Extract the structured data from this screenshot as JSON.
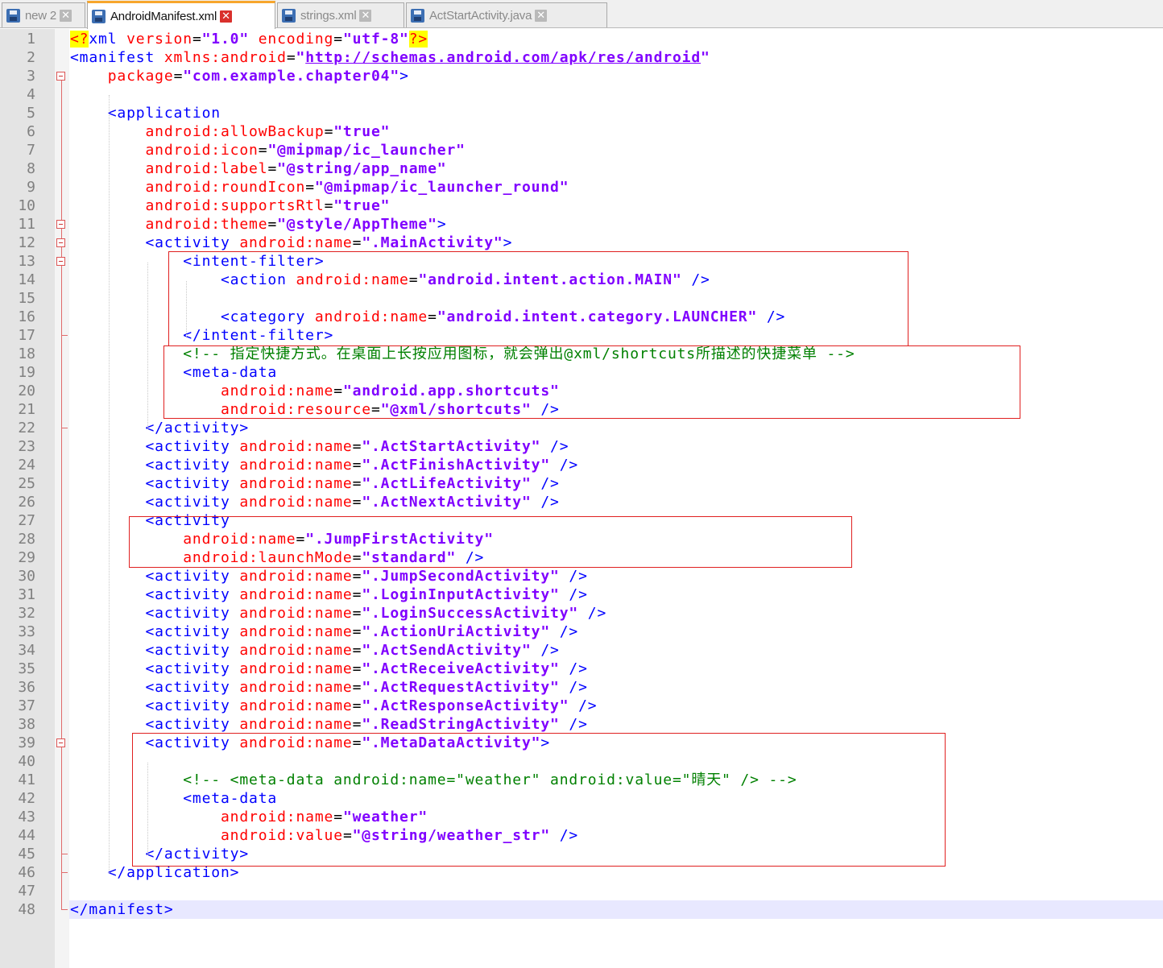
{
  "tabs": [
    {
      "label": "new 2",
      "active": false
    },
    {
      "label": "AndroidManifest.xml",
      "active": true
    },
    {
      "label": "strings.xml",
      "active": false
    },
    {
      "label": "ActStartActivity.java",
      "active": false
    }
  ],
  "close_glyph": "✕",
  "colors": {
    "tag": "#0000ff",
    "attribute": "#ff0000",
    "value": "#8000ff",
    "comment": "#008000",
    "highlight_box": "#e02020",
    "current_line": "#e8e8ff",
    "active_tab_accent": "#f7a62c"
  },
  "current_line": 48,
  "lines": [
    {
      "n": "1",
      "segs": [
        [
          "pi",
          "<?"
        ],
        [
          "tg",
          "xml "
        ],
        [
          "at",
          "version"
        ],
        [
          "eq",
          "="
        ],
        [
          "vl",
          "\"1.0\""
        ],
        [
          "tg",
          " "
        ],
        [
          "at",
          "encoding"
        ],
        [
          "eq",
          "="
        ],
        [
          "vl",
          "\"utf-8\""
        ],
        [
          "pi",
          "?>"
        ]
      ]
    },
    {
      "n": "2",
      "segs": [
        [
          "tg",
          "<manifest "
        ],
        [
          "at",
          "xmlns:android"
        ],
        [
          "eq",
          "="
        ],
        [
          "vl",
          "\""
        ],
        [
          "url",
          "http://schemas.android.com/apk/res/android"
        ],
        [
          "vl",
          "\""
        ]
      ]
    },
    {
      "n": "3",
      "segs": [
        [
          "tg",
          "    "
        ],
        [
          "at",
          "package"
        ],
        [
          "eq",
          "="
        ],
        [
          "vl",
          "\"com.example.chapter04\""
        ],
        [
          "tg",
          ">"
        ]
      ]
    },
    {
      "n": "4",
      "segs": []
    },
    {
      "n": "5",
      "segs": [
        [
          "tg",
          "    <application"
        ]
      ]
    },
    {
      "n": "6",
      "segs": [
        [
          "tg",
          "        "
        ],
        [
          "at",
          "android:allowBackup"
        ],
        [
          "eq",
          "="
        ],
        [
          "vl",
          "\"true\""
        ]
      ]
    },
    {
      "n": "7",
      "segs": [
        [
          "tg",
          "        "
        ],
        [
          "at",
          "android:icon"
        ],
        [
          "eq",
          "="
        ],
        [
          "vl",
          "\"@mipmap/ic_launcher\""
        ]
      ]
    },
    {
      "n": "8",
      "segs": [
        [
          "tg",
          "        "
        ],
        [
          "at",
          "android:label"
        ],
        [
          "eq",
          "="
        ],
        [
          "vl",
          "\"@string/app_name\""
        ]
      ]
    },
    {
      "n": "9",
      "segs": [
        [
          "tg",
          "        "
        ],
        [
          "at",
          "android:roundIcon"
        ],
        [
          "eq",
          "="
        ],
        [
          "vl",
          "\"@mipmap/ic_launcher_round\""
        ]
      ]
    },
    {
      "n": "10",
      "segs": [
        [
          "tg",
          "        "
        ],
        [
          "at",
          "android:supportsRtl"
        ],
        [
          "eq",
          "="
        ],
        [
          "vl",
          "\"true\""
        ]
      ]
    },
    {
      "n": "11",
      "segs": [
        [
          "tg",
          "        "
        ],
        [
          "at",
          "android:theme"
        ],
        [
          "eq",
          "="
        ],
        [
          "vl",
          "\"@style/AppTheme\""
        ],
        [
          "tg",
          ">"
        ]
      ]
    },
    {
      "n": "12",
      "segs": [
        [
          "tg",
          "        <activity "
        ],
        [
          "at",
          "android:name"
        ],
        [
          "eq",
          "="
        ],
        [
          "vl",
          "\".MainActivity\""
        ],
        [
          "tg",
          ">"
        ]
      ]
    },
    {
      "n": "13",
      "segs": [
        [
          "tg",
          "            <intent-filter>"
        ]
      ]
    },
    {
      "n": "14",
      "segs": [
        [
          "tg",
          "                <action "
        ],
        [
          "at",
          "android:name"
        ],
        [
          "eq",
          "="
        ],
        [
          "vl",
          "\"android.intent.action.MAIN\""
        ],
        [
          "tg",
          " />"
        ]
      ]
    },
    {
      "n": "15",
      "segs": []
    },
    {
      "n": "16",
      "segs": [
        [
          "tg",
          "                <category "
        ],
        [
          "at",
          "android:name"
        ],
        [
          "eq",
          "="
        ],
        [
          "vl",
          "\"android.intent.category.LAUNCHER\""
        ],
        [
          "tg",
          " />"
        ]
      ]
    },
    {
      "n": "17",
      "segs": [
        [
          "tg",
          "            </intent-filter>"
        ]
      ]
    },
    {
      "n": "18",
      "segs": [
        [
          "tg",
          "            "
        ],
        [
          "cm",
          "<!-- 指定快捷方式。在桌面上长按应用图标，就会弹出@xml/shortcuts所描述的快捷菜单 -->"
        ]
      ]
    },
    {
      "n": "19",
      "segs": [
        [
          "tg",
          "            <meta-data"
        ]
      ]
    },
    {
      "n": "20",
      "segs": [
        [
          "tg",
          "                "
        ],
        [
          "at",
          "android:name"
        ],
        [
          "eq",
          "="
        ],
        [
          "vl",
          "\"android.app.shortcuts\""
        ]
      ]
    },
    {
      "n": "21",
      "segs": [
        [
          "tg",
          "                "
        ],
        [
          "at",
          "android:resource"
        ],
        [
          "eq",
          "="
        ],
        [
          "vl",
          "\"@xml/shortcuts\""
        ],
        [
          "tg",
          " />"
        ]
      ]
    },
    {
      "n": "22",
      "segs": [
        [
          "tg",
          "        </activity>"
        ]
      ]
    },
    {
      "n": "23",
      "segs": [
        [
          "tg",
          "        <activity "
        ],
        [
          "at",
          "android:name"
        ],
        [
          "eq",
          "="
        ],
        [
          "vl",
          "\".ActStartActivity\""
        ],
        [
          "tg",
          " />"
        ]
      ]
    },
    {
      "n": "24",
      "segs": [
        [
          "tg",
          "        <activity "
        ],
        [
          "at",
          "android:name"
        ],
        [
          "eq",
          "="
        ],
        [
          "vl",
          "\".ActFinishActivity\""
        ],
        [
          "tg",
          " />"
        ]
      ]
    },
    {
      "n": "25",
      "segs": [
        [
          "tg",
          "        <activity "
        ],
        [
          "at",
          "android:name"
        ],
        [
          "eq",
          "="
        ],
        [
          "vl",
          "\".ActLifeActivity\""
        ],
        [
          "tg",
          " />"
        ]
      ]
    },
    {
      "n": "26",
      "segs": [
        [
          "tg",
          "        <activity "
        ],
        [
          "at",
          "android:name"
        ],
        [
          "eq",
          "="
        ],
        [
          "vl",
          "\".ActNextActivity\""
        ],
        [
          "tg",
          " />"
        ]
      ]
    },
    {
      "n": "27",
      "segs": [
        [
          "tg",
          "        <activity"
        ]
      ]
    },
    {
      "n": "28",
      "segs": [
        [
          "tg",
          "            "
        ],
        [
          "at",
          "android:name"
        ],
        [
          "eq",
          "="
        ],
        [
          "vl",
          "\".JumpFirstActivity\""
        ]
      ]
    },
    {
      "n": "29",
      "segs": [
        [
          "tg",
          "            "
        ],
        [
          "at",
          "android:launchMode"
        ],
        [
          "eq",
          "="
        ],
        [
          "vl",
          "\"standard\""
        ],
        [
          "tg",
          " />"
        ]
      ]
    },
    {
      "n": "30",
      "segs": [
        [
          "tg",
          "        <activity "
        ],
        [
          "at",
          "android:name"
        ],
        [
          "eq",
          "="
        ],
        [
          "vl",
          "\".JumpSecondActivity\""
        ],
        [
          "tg",
          " />"
        ]
      ]
    },
    {
      "n": "31",
      "segs": [
        [
          "tg",
          "        <activity "
        ],
        [
          "at",
          "android:name"
        ],
        [
          "eq",
          "="
        ],
        [
          "vl",
          "\".LoginInputActivity\""
        ],
        [
          "tg",
          " />"
        ]
      ]
    },
    {
      "n": "32",
      "segs": [
        [
          "tg",
          "        <activity "
        ],
        [
          "at",
          "android:name"
        ],
        [
          "eq",
          "="
        ],
        [
          "vl",
          "\".LoginSuccessActivity\""
        ],
        [
          "tg",
          " />"
        ]
      ]
    },
    {
      "n": "33",
      "segs": [
        [
          "tg",
          "        <activity "
        ],
        [
          "at",
          "android:name"
        ],
        [
          "eq",
          "="
        ],
        [
          "vl",
          "\".ActionUriActivity\""
        ],
        [
          "tg",
          " />"
        ]
      ]
    },
    {
      "n": "34",
      "segs": [
        [
          "tg",
          "        <activity "
        ],
        [
          "at",
          "android:name"
        ],
        [
          "eq",
          "="
        ],
        [
          "vl",
          "\".ActSendActivity\""
        ],
        [
          "tg",
          " />"
        ]
      ]
    },
    {
      "n": "35",
      "segs": [
        [
          "tg",
          "        <activity "
        ],
        [
          "at",
          "android:name"
        ],
        [
          "eq",
          "="
        ],
        [
          "vl",
          "\".ActReceiveActivity\""
        ],
        [
          "tg",
          " />"
        ]
      ]
    },
    {
      "n": "36",
      "segs": [
        [
          "tg",
          "        <activity "
        ],
        [
          "at",
          "android:name"
        ],
        [
          "eq",
          "="
        ],
        [
          "vl",
          "\".ActRequestActivity\""
        ],
        [
          "tg",
          " />"
        ]
      ]
    },
    {
      "n": "37",
      "segs": [
        [
          "tg",
          "        <activity "
        ],
        [
          "at",
          "android:name"
        ],
        [
          "eq",
          "="
        ],
        [
          "vl",
          "\".ActResponseActivity\""
        ],
        [
          "tg",
          " />"
        ]
      ]
    },
    {
      "n": "38",
      "segs": [
        [
          "tg",
          "        <activity "
        ],
        [
          "at",
          "android:name"
        ],
        [
          "eq",
          "="
        ],
        [
          "vl",
          "\".ReadStringActivity\""
        ],
        [
          "tg",
          " />"
        ]
      ]
    },
    {
      "n": "39",
      "segs": [
        [
          "tg",
          "        <activity "
        ],
        [
          "at",
          "android:name"
        ],
        [
          "eq",
          "="
        ],
        [
          "vl",
          "\".MetaDataActivity\""
        ],
        [
          "tg",
          ">"
        ]
      ]
    },
    {
      "n": "40",
      "segs": []
    },
    {
      "n": "41",
      "segs": [
        [
          "tg",
          "            "
        ],
        [
          "cm",
          "<!-- <meta-data android:name=\"weather\" android:value=\"晴天\" /> -->"
        ]
      ]
    },
    {
      "n": "42",
      "segs": [
        [
          "tg",
          "            <meta-data"
        ]
      ]
    },
    {
      "n": "43",
      "segs": [
        [
          "tg",
          "                "
        ],
        [
          "at",
          "android:name"
        ],
        [
          "eq",
          "="
        ],
        [
          "vl",
          "\"weather\""
        ]
      ]
    },
    {
      "n": "44",
      "segs": [
        [
          "tg",
          "                "
        ],
        [
          "at",
          "android:value"
        ],
        [
          "eq",
          "="
        ],
        [
          "vl",
          "\"@string/weather_str\""
        ],
        [
          "tg",
          " />"
        ]
      ]
    },
    {
      "n": "45",
      "segs": [
        [
          "tg",
          "        </activity>"
        ]
      ]
    },
    {
      "n": "46",
      "segs": [
        [
          "tg",
          "    </application>"
        ]
      ]
    },
    {
      "n": "47",
      "segs": []
    },
    {
      "n": "48",
      "segs": [
        [
          "tg",
          "</manifest>"
        ]
      ]
    }
  ]
}
